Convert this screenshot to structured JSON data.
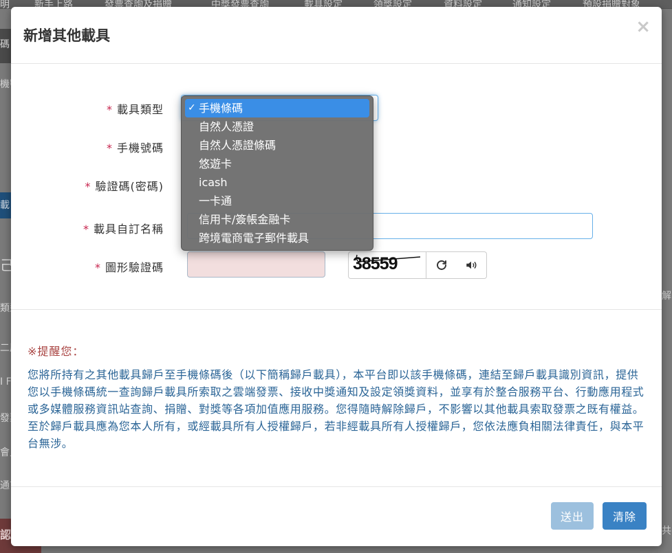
{
  "background": {
    "nav_items": [
      "明",
      "新手上路",
      "發票查詢及捐贈",
      "中獎發票查詢",
      "載具設定",
      "領獎設定",
      "資料設定",
      "通知設定",
      "預設捐贈對象"
    ],
    "sub_label": "碼",
    "left_labels": [
      "機號",
      "載",
      "己",
      "類型",
      "二厲",
      "I F",
      "發票",
      "會員",
      "通言",
      "認"
    ],
    "right_labels": [
      "解",
      "共"
    ]
  },
  "modal": {
    "title": "新增其他載具",
    "close_symbol": "×",
    "fields": {
      "carrier_type_label": "載具類型",
      "phone_barcode_label": "手機號碼",
      "verify_code_label": "驗證碼(密碼)",
      "custom_name_label": "載具自訂名稱",
      "captcha_label": "圖形驗證碼",
      "required_mark": "*",
      "captcha_text": "38559",
      "captcha_input_value": "",
      "custom_name_value": ""
    },
    "carrier_options": [
      {
        "label": "手機條碼",
        "selected": true
      },
      {
        "label": "自然人憑證",
        "selected": false
      },
      {
        "label": "自然人憑證條碼",
        "selected": false
      },
      {
        "label": "悠遊卡",
        "selected": false
      },
      {
        "label": "icash",
        "selected": false
      },
      {
        "label": "一卡通",
        "selected": false
      },
      {
        "label": "信用卡/簽帳金融卡",
        "selected": false
      },
      {
        "label": "跨境電商電子郵件載具",
        "selected": false
      }
    ],
    "check_symbol": "✓",
    "reminder": {
      "title": "※提醒您：",
      "body": "您將所持有之其他載具歸戶至手機條碼後（以下簡稱歸戶載具），本平台即以該手機條碼，連結至歸戶載具識別資訊，提供您以手機條碼統一查詢歸戶載具所索取之雲端發票、接收中獎通知及設定領獎資料，並享有於整合服務平台、行動應用程式或多媒體服務資訊站查詢、捐贈、對獎等各項加值應用服務。您得隨時解除歸戶，不影響以其他載具索取發票之既有權益。至於歸戶載具應為您本人所有，或經載具所有人授權歸戶，若非經載具所有人授權歸戶，您依法應負相關法律責任，與本平台無涉。"
    },
    "buttons": {
      "submit": "送出",
      "clear": "清除"
    },
    "icons": {
      "refresh": "refresh-icon",
      "audio": "volume-icon"
    },
    "colors": {
      "primary": "#3a82c4",
      "primary_disabled": "#9cc0de",
      "required": "#c7254e",
      "reminder_title": "#a94442",
      "reminder_body": "#2a6496",
      "dropdown_highlight": "#3a8ee6"
    }
  }
}
